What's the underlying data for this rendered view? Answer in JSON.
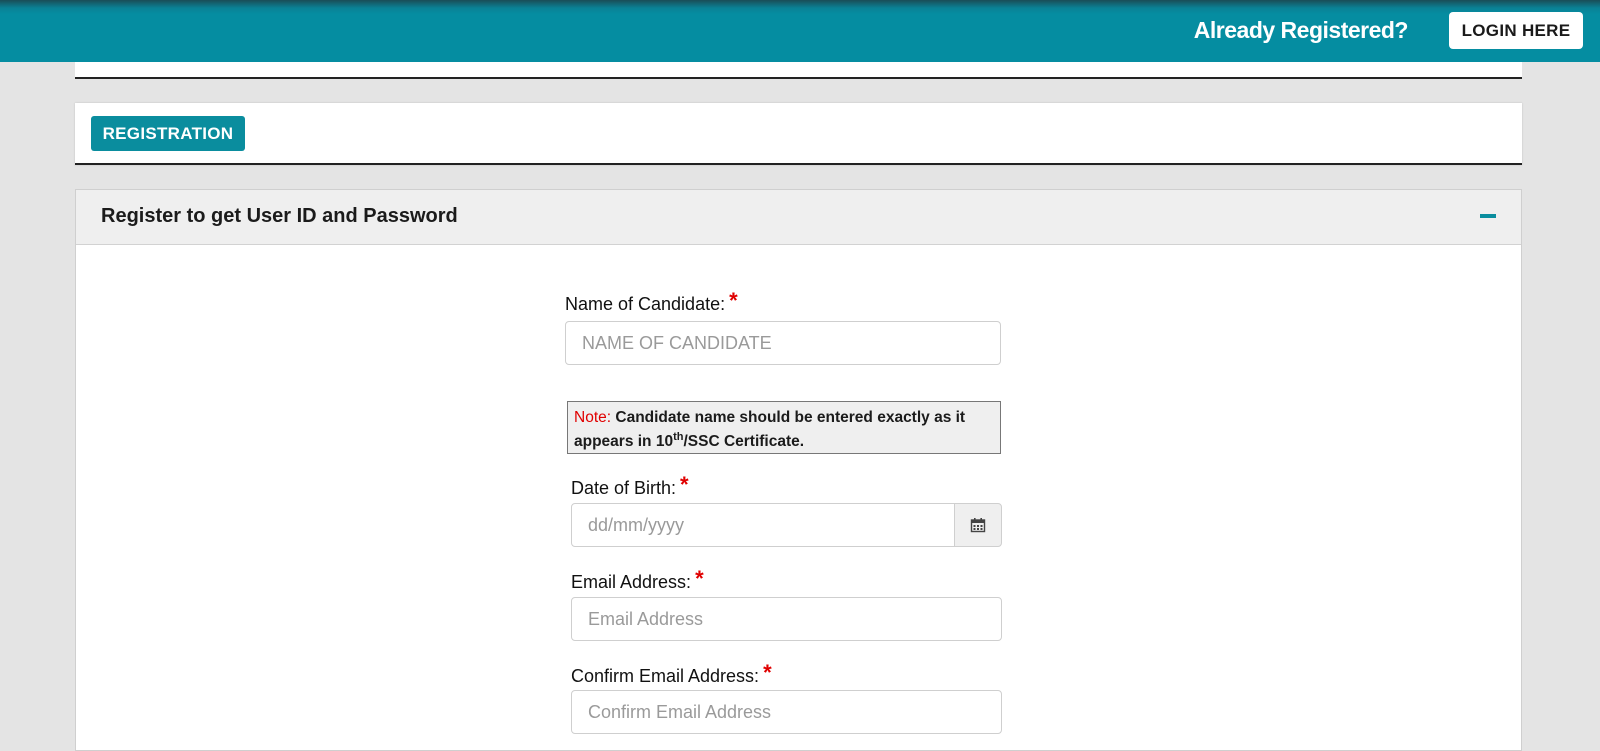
{
  "header": {
    "already_registered": "Already Registered?",
    "login_label": "LOGIN HERE"
  },
  "tabs": {
    "registration_label": "REGISTRATION"
  },
  "panel": {
    "title": "Register to get User ID and Password",
    "collapse_icon": "minus-icon"
  },
  "form": {
    "name": {
      "label": "Name of Candidate:",
      "required_mark": "*",
      "placeholder": "NAME OF CANDIDATE"
    },
    "note": {
      "label": "Note:",
      "text_before": "Candidate name should be entered exactly as it appears in 10",
      "sup": "th",
      "text_after": "/SSC Certificate."
    },
    "dob": {
      "label": "Date of Birth:",
      "required_mark": "*",
      "placeholder": "dd/mm/yyyy",
      "icon": "calendar-icon"
    },
    "email": {
      "label": "Email Address:",
      "required_mark": "*",
      "placeholder": "Email Address"
    },
    "confirm_email": {
      "label": "Confirm Email Address:",
      "required_mark": "*",
      "placeholder": "Confirm Email Address"
    }
  },
  "colors": {
    "brand": "#058da1",
    "required": "#e00000",
    "note_label": "#e00000"
  }
}
